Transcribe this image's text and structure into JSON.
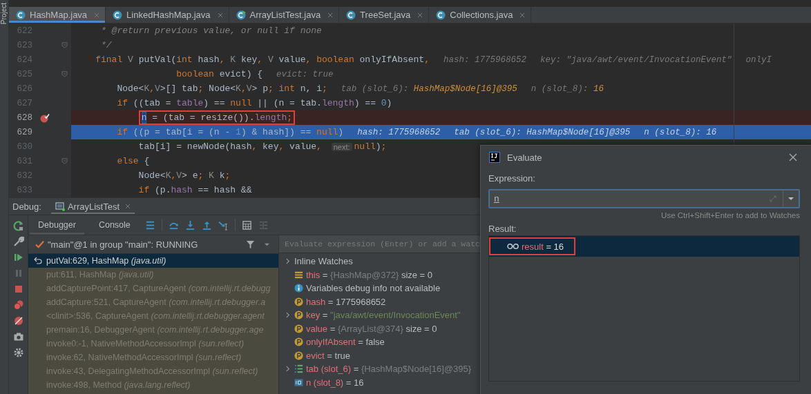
{
  "side_strip": {
    "label": "Project"
  },
  "editor_tabs": [
    {
      "label": "HashMap.java",
      "selected": true,
      "kind": "class"
    },
    {
      "label": "LinkedHashMap.java",
      "selected": false,
      "kind": "class"
    },
    {
      "label": "ArrayListTest.java",
      "selected": false,
      "kind": "runnable"
    },
    {
      "label": "TreeSet.java",
      "selected": false,
      "kind": "class"
    },
    {
      "label": "Collections.java",
      "selected": false,
      "kind": "class"
    }
  ],
  "editor": {
    "lines": [
      {
        "number": "622",
        "fold": false,
        "breakpoint": false,
        "current": false,
        "boxed": false,
        "tokens": [
          {
            "kind": "comment",
            "text": "     * @return previous value, or null if none"
          }
        ]
      },
      {
        "number": "623",
        "fold": true,
        "breakpoint": false,
        "current": false,
        "boxed": false,
        "tokens": [
          {
            "kind": "comment",
            "text": "     */"
          }
        ]
      },
      {
        "number": "624",
        "fold": false,
        "breakpoint": false,
        "current": false,
        "boxed": false,
        "tokens": [
          {
            "kind": "kw",
            "text": "    final "
          },
          {
            "kind": "tv",
            "text": "V "
          },
          {
            "kind": "id",
            "text": "putVal("
          },
          {
            "kind": "kw",
            "text": "int "
          },
          {
            "kind": "id",
            "text": "hash"
          },
          {
            "kind": "kw",
            "text": ", "
          },
          {
            "kind": "tv",
            "text": "K "
          },
          {
            "kind": "id",
            "text": "key"
          },
          {
            "kind": "kw",
            "text": ", "
          },
          {
            "kind": "tv",
            "text": "V "
          },
          {
            "kind": "id",
            "text": "value"
          },
          {
            "kind": "kw",
            "text": ", boolean "
          },
          {
            "kind": "id",
            "text": "onlyIfAbsent"
          },
          {
            "kind": "kw",
            "text": ","
          },
          {
            "kind": "hint",
            "text": "hash: 1775968652"
          },
          {
            "kind": "hint",
            "text": "key: \"java/awt/event/InvocationEvent\""
          },
          {
            "kind": "hint",
            "text": "onlyI"
          }
        ]
      },
      {
        "number": "625",
        "fold": true,
        "breakpoint": false,
        "current": false,
        "boxed": false,
        "tokens": [
          {
            "kind": "kw",
            "text": "                   boolean "
          },
          {
            "kind": "id",
            "text": "evict) {"
          },
          {
            "kind": "hint",
            "text": "evict: true"
          }
        ]
      },
      {
        "number": "626",
        "fold": false,
        "breakpoint": false,
        "current": false,
        "boxed": false,
        "tokens": [
          {
            "kind": "id",
            "text": "        Node<"
          },
          {
            "kind": "tv",
            "text": "K"
          },
          {
            "kind": "kw",
            "text": ","
          },
          {
            "kind": "tv",
            "text": "V"
          },
          {
            "kind": "id",
            "text": ">[] tab"
          },
          {
            "kind": "kw",
            "text": "; "
          },
          {
            "kind": "id",
            "text": "Node<"
          },
          {
            "kind": "tv",
            "text": "K"
          },
          {
            "kind": "kw",
            "text": ","
          },
          {
            "kind": "tv",
            "text": "V"
          },
          {
            "kind": "id",
            "text": "> p"
          },
          {
            "kind": "kw",
            "text": "; int "
          },
          {
            "kind": "id",
            "text": "n, i"
          },
          {
            "kind": "kw",
            "text": ";"
          },
          {
            "kind": "hint",
            "text": "tab (slot_6):",
            "value": "HashMap$Node[16]@395"
          },
          {
            "kind": "hint",
            "text": "n (slot_8):",
            "value": "16"
          }
        ]
      },
      {
        "number": "627",
        "fold": false,
        "breakpoint": false,
        "current": false,
        "boxed": false,
        "tokens": [
          {
            "kind": "kw",
            "text": "        if "
          },
          {
            "kind": "id",
            "text": "((tab = "
          },
          {
            "kind": "field",
            "text": "table"
          },
          {
            "kind": "id",
            "text": ") == "
          },
          {
            "kind": "kw",
            "text": "null "
          },
          {
            "kind": "id",
            "text": "|| (n = tab."
          },
          {
            "kind": "field",
            "text": "length"
          },
          {
            "kind": "id",
            "text": ") == "
          },
          {
            "kind": "num",
            "text": "0"
          },
          {
            "kind": "id",
            "text": ")"
          }
        ]
      },
      {
        "number": "628",
        "fold": false,
        "breakpoint": true,
        "current": false,
        "boxed": true,
        "tokens": [
          {
            "kind": "selword",
            "text": "            n"
          },
          {
            "kind": "id",
            "text": " = (tab = resize())."
          },
          {
            "kind": "field",
            "text": "length"
          },
          {
            "kind": "kw",
            "text": ";"
          }
        ]
      },
      {
        "number": "629",
        "fold": false,
        "breakpoint": false,
        "current": true,
        "boxed": false,
        "tokens": [
          {
            "kind": "kw",
            "text": "        if "
          },
          {
            "kind": "id",
            "text": "((p = tab[i = (n - "
          },
          {
            "kind": "num",
            "text": "1"
          },
          {
            "kind": "id",
            "text": ") & hash]) == "
          },
          {
            "kind": "kw",
            "text": "null"
          },
          {
            "kind": "id",
            "text": ")"
          },
          {
            "kind": "hint",
            "text": "hash: 1775968652"
          },
          {
            "kind": "hint",
            "text": "tab (slot_6): HashMap$Node[16]@395"
          },
          {
            "kind": "hint",
            "text": "n (slot_8): 16"
          }
        ]
      },
      {
        "number": "630",
        "fold": false,
        "breakpoint": false,
        "current": false,
        "boxed": false,
        "tokens": [
          {
            "kind": "id",
            "text": "            tab[i] = newNode(hash"
          },
          {
            "kind": "kw",
            "text": ", "
          },
          {
            "kind": "id",
            "text": "key"
          },
          {
            "kind": "kw",
            "text": ", "
          },
          {
            "kind": "id",
            "text": "value"
          },
          {
            "kind": "kw",
            "text": ", "
          },
          {
            "kind": "param",
            "text": "next:"
          },
          {
            "kind": "kw",
            "text": "null"
          },
          {
            "kind": "id",
            "text": ")"
          },
          {
            "kind": "kw",
            "text": ";"
          }
        ]
      },
      {
        "number": "631",
        "fold": true,
        "breakpoint": false,
        "current": false,
        "boxed": false,
        "tokens": [
          {
            "kind": "kw",
            "text": "        else "
          },
          {
            "kind": "id",
            "text": "{"
          }
        ]
      },
      {
        "number": "632",
        "fold": false,
        "breakpoint": false,
        "current": false,
        "boxed": false,
        "tokens": [
          {
            "kind": "id",
            "text": "            Node<"
          },
          {
            "kind": "tv",
            "text": "K"
          },
          {
            "kind": "kw",
            "text": ","
          },
          {
            "kind": "tv",
            "text": "V"
          },
          {
            "kind": "id",
            "text": "> e"
          },
          {
            "kind": "kw",
            "text": "; "
          },
          {
            "kind": "tv",
            "text": "K "
          },
          {
            "kind": "id",
            "text": "k"
          },
          {
            "kind": "kw",
            "text": ";"
          }
        ]
      },
      {
        "number": "633",
        "fold": false,
        "breakpoint": false,
        "current": false,
        "boxed": false,
        "tokens": [
          {
            "kind": "kw",
            "text": "            if "
          },
          {
            "kind": "id",
            "text": "(p."
          },
          {
            "kind": "field",
            "text": "hash "
          },
          {
            "kind": "id",
            "text": "== hash &&"
          }
        ]
      }
    ]
  },
  "debug_header": {
    "label": "Debug:",
    "session_tab": "ArrayListTest"
  },
  "debug_tabs": [
    {
      "label": "Debugger",
      "selected": true
    },
    {
      "label": "Console",
      "selected": false
    }
  ],
  "thread": {
    "label": "\"main\"@1 in group \"main\": RUNNING"
  },
  "frames": [
    {
      "method": "putVal:629, HashMap",
      "package": "(java.util)",
      "selected": true
    },
    {
      "method": "put:611, HashMap",
      "package": "(java.util)",
      "selected": false
    },
    {
      "method": "addCapturePoint:417, CaptureAgent",
      "package": "(com.intellij.rt.debugg",
      "selected": false
    },
    {
      "method": "addCapture:521, CaptureAgent",
      "package": "(com.intellij.rt.debugger.a",
      "selected": false
    },
    {
      "method": "<clinit>:536, CaptureAgent",
      "package": "(com.intellij.rt.debugger.agent",
      "selected": false
    },
    {
      "method": "premain:16, DebuggerAgent",
      "package": "(com.intellij.rt.debugger.age",
      "selected": false
    },
    {
      "method": "invoke0:-1, NativeMethodAccessorImpl",
      "package": "(sun.reflect)",
      "selected": false
    },
    {
      "method": "invoke:62, NativeMethodAccessorImpl",
      "package": "(sun.reflect)",
      "selected": false
    },
    {
      "method": "invoke:43, DelegatingMethodAccessorImpl",
      "package": "(sun.reflect)",
      "selected": false
    },
    {
      "method": "invoke:498, Method",
      "package": "(java.lang.reflect)",
      "selected": false
    }
  ],
  "variables": {
    "placeholder": "Evaluate expression (Enter) or add a watc",
    "items": [
      {
        "kind": "watches",
        "expandable": true,
        "name": "Inline Watches"
      },
      {
        "kind": "field",
        "expandable": false,
        "name": "this",
        "operator": "=",
        "value": {
          "text": "{HashMap@372}",
          "kind": "object"
        },
        "extra": "size = 0"
      },
      {
        "kind": "info",
        "expandable": false,
        "name": "Variables debug info not available"
      },
      {
        "kind": "param",
        "expandable": false,
        "name": "hash",
        "operator": "=",
        "value": {
          "text": "1775968652",
          "kind": "plain"
        }
      },
      {
        "kind": "param",
        "expandable": true,
        "name": "key",
        "operator": "=",
        "value": {
          "text": "\"java/awt/event/InvocationEvent\"",
          "kind": "string"
        }
      },
      {
        "kind": "param",
        "expandable": false,
        "name": "value",
        "operator": "=",
        "value": {
          "text": "{ArrayList@374}",
          "kind": "object"
        },
        "extra": "size = 0"
      },
      {
        "kind": "param",
        "expandable": false,
        "name": "onlyIfAbsent",
        "operator": "=",
        "value": {
          "text": "false",
          "kind": "plain"
        }
      },
      {
        "kind": "param",
        "expandable": false,
        "name": "evict",
        "operator": "=",
        "value": {
          "text": "true",
          "kind": "plain"
        }
      },
      {
        "kind": "array",
        "expandable": true,
        "name": "tab (slot_6)",
        "operator": "=",
        "value": {
          "text": "{HashMap$Node[16]@395}",
          "kind": "object"
        }
      },
      {
        "kind": "int",
        "expandable": false,
        "name": "n (slot_8)",
        "operator": "=",
        "value": {
          "text": "16",
          "kind": "plain"
        }
      }
    ]
  },
  "evaluate_dialog": {
    "title": "Evaluate",
    "expression_label": "Expression:",
    "expression": "n",
    "hint": "Use Ctrl+Shift+Enter to add to Watches",
    "result_label": "Result:",
    "results": [
      {
        "name": "result",
        "operator": "=",
        "value": "16",
        "selected": true,
        "boxed": true
      }
    ]
  }
}
